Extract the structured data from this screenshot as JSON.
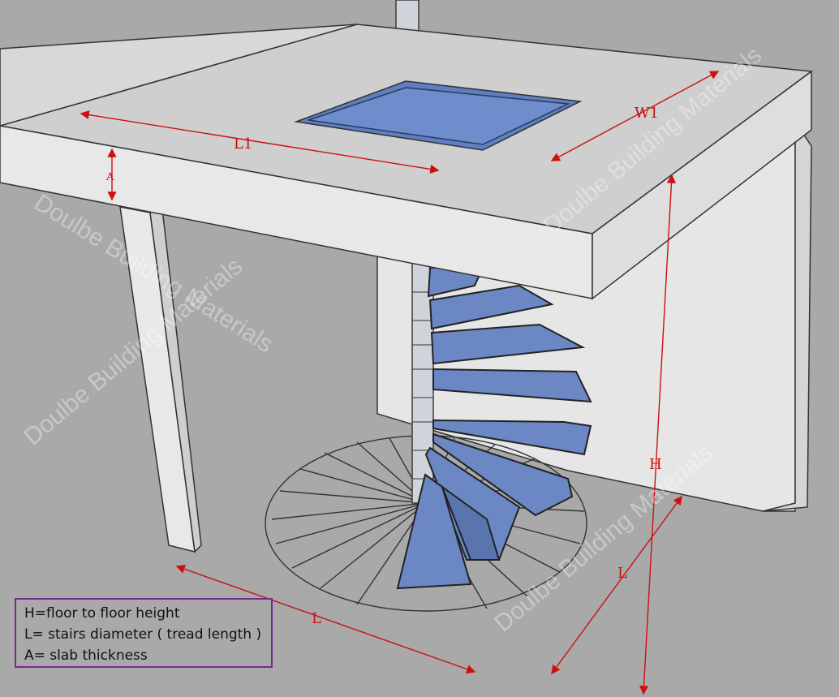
{
  "dimension_labels": {
    "l1": "L1",
    "w1": "W1",
    "a": "A",
    "h": "H",
    "l_left": "L",
    "l_right": "L"
  },
  "legend": {
    "line1": "H=floor to floor height",
    "line2": "L= stairs diameter ( tread length )",
    "line3": "A= slab thickness"
  },
  "watermark": "Doulbe Building Materials",
  "colors": {
    "floor": "#a9a9a9",
    "wall": "#e6e6e6",
    "glass": "#5f7fc0",
    "dimension": "#cc1010",
    "legend_border": "#7a2a8c"
  },
  "icons": [
    "spiral-staircase-icon"
  ]
}
